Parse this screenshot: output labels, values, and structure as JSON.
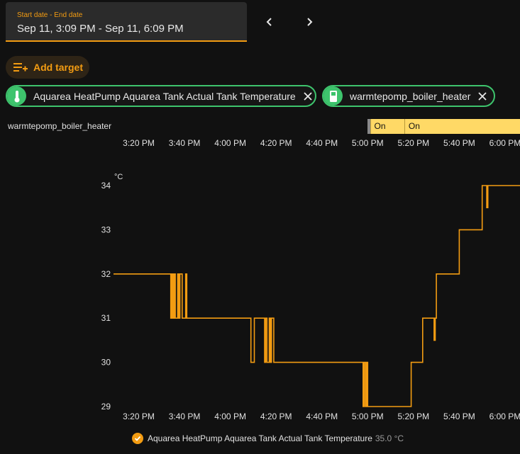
{
  "date_picker": {
    "label": "Start date - End date",
    "value": "Sep 11, 3:09 PM - Sep 11, 6:09 PM"
  },
  "toolbar": {
    "prev_icon": "chevron-left-icon",
    "next_icon": "chevron-right-icon",
    "add_target_label": "Add target",
    "add_target_icon": "playlist-plus-icon"
  },
  "targets": [
    {
      "label": "Aquarea HeatPump Aquarea Tank Actual Tank Temperature",
      "icon": "thermometer-icon"
    },
    {
      "label": "warmtepomp_boiler_heater",
      "icon": "socket-icon"
    }
  ],
  "timeline": {
    "entity": "warmtepomp_boiler_heater",
    "state_label": "On",
    "segments": [
      {
        "start": "17:00",
        "end": "17:01",
        "state": "",
        "color": "#8a8a8a"
      },
      {
        "start": "17:01",
        "end": "17:16",
        "state": "On",
        "color": "#ffd966"
      },
      {
        "start": "17:16",
        "end": "18:09",
        "state": "On",
        "color": "#ffd966"
      }
    ],
    "axis_start": "15:09",
    "axis_end": "18:09",
    "ticks": [
      "3:20 PM",
      "3:40 PM",
      "4:00 PM",
      "4:20 PM",
      "4:40 PM",
      "5:00 PM",
      "5:20 PM",
      "5:40 PM",
      "6:00 PM"
    ]
  },
  "chart_data": {
    "type": "line",
    "x_start": "15:09",
    "x_end": "18:09",
    "x_ticks": [
      "3:20 PM",
      "3:40 PM",
      "4:00 PM",
      "4:20 PM",
      "4:40 PM",
      "5:00 PM",
      "5:20 PM",
      "5:40 PM",
      "6:00 PM"
    ],
    "y_ticks": [
      29,
      30,
      31,
      32,
      33,
      34
    ],
    "ylim": [
      29,
      34.2
    ],
    "unit": "°C",
    "color": "#f39c12",
    "series": [
      {
        "name": "Aquarea HeatPump Aquarea Tank Actual Tank Temperature",
        "points": [
          [
            "15:09",
            32
          ],
          [
            "15:34",
            32
          ],
          [
            "15:34",
            31
          ],
          [
            "15:34.5",
            31
          ],
          [
            "15:34.5",
            32
          ],
          [
            "15:35",
            32
          ],
          [
            "15:35",
            31
          ],
          [
            "15:35.5",
            31
          ],
          [
            "15:35.5",
            32
          ],
          [
            "15:36",
            32
          ],
          [
            "15:36",
            31
          ],
          [
            "15:37",
            31
          ],
          [
            "15:37",
            32
          ],
          [
            "15:37.5",
            32
          ],
          [
            "15:37.5",
            31
          ],
          [
            "15:38",
            31
          ],
          [
            "15:38",
            32
          ],
          [
            "15:39",
            32
          ],
          [
            "15:39",
            31
          ],
          [
            "15:40.5",
            31
          ],
          [
            "15:40.5",
            32
          ],
          [
            "15:41",
            32
          ],
          [
            "15:41",
            31
          ],
          [
            "16:09",
            31
          ],
          [
            "16:09",
            30
          ],
          [
            "16:10.5",
            30
          ],
          [
            "16:10.5",
            31
          ],
          [
            "16:15",
            31
          ],
          [
            "16:15",
            30
          ],
          [
            "16:15.5",
            30
          ],
          [
            "16:15.5",
            31
          ],
          [
            "16:16",
            31
          ],
          [
            "16:16",
            30
          ],
          [
            "16:17",
            30
          ],
          [
            "16:17",
            31
          ],
          [
            "16:17.5",
            31
          ],
          [
            "16:17.5",
            30
          ],
          [
            "16:18",
            30
          ],
          [
            "16:18",
            31
          ],
          [
            "16:19",
            31
          ],
          [
            "16:19",
            30
          ],
          [
            "16:58",
            30
          ],
          [
            "16:58",
            29
          ],
          [
            "16:58.5",
            29
          ],
          [
            "16:58.5",
            30
          ],
          [
            "16:59",
            30
          ],
          [
            "16:59",
            29
          ],
          [
            "16:59.5",
            29
          ],
          [
            "16:59.5",
            30
          ],
          [
            "17:00",
            30
          ],
          [
            "17:00",
            29
          ],
          [
            "17:19",
            29
          ],
          [
            "17:19",
            30
          ],
          [
            "17:24",
            30
          ],
          [
            "17:24",
            31
          ],
          [
            "17:29",
            31
          ],
          [
            "17:29",
            30.5
          ],
          [
            "17:29.5",
            30.5
          ],
          [
            "17:29.5",
            31
          ],
          [
            "17:30",
            31
          ],
          [
            "17:30",
            32
          ],
          [
            "17:40",
            32
          ],
          [
            "17:40",
            33
          ],
          [
            "17:50",
            33
          ],
          [
            "17:50",
            34
          ],
          [
            "17:52",
            34
          ],
          [
            "17:52",
            33.5
          ],
          [
            "17:52.5",
            33.5
          ],
          [
            "17:52.5",
            34
          ],
          [
            "18:09",
            34
          ]
        ],
        "current_value": "35.0 °C"
      }
    ]
  },
  "legend": {
    "label": "Aquarea HeatPump Aquarea Tank Actual Tank Temperature",
    "value": "35.0 °C",
    "icon": "check-circle-icon"
  }
}
